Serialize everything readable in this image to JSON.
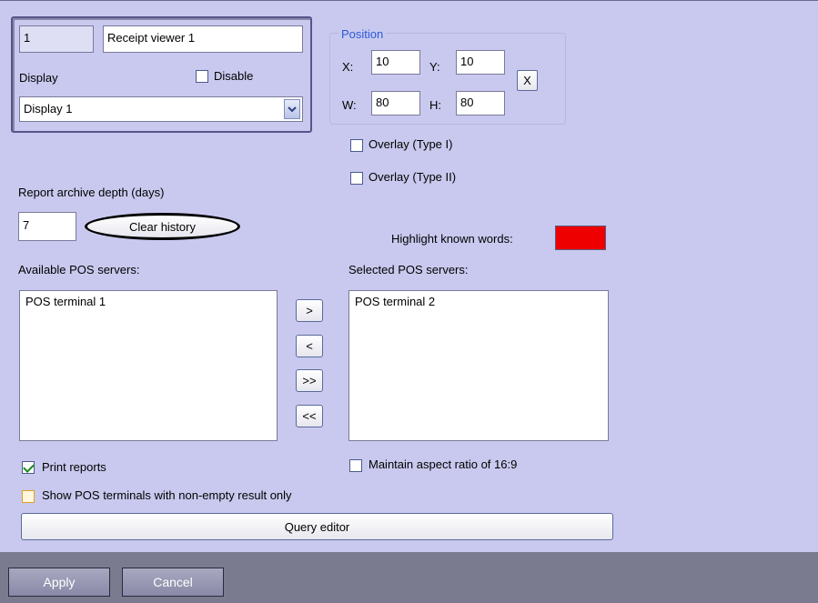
{
  "camera": {
    "id": "1",
    "name": "Receipt viewer 1"
  },
  "display": {
    "label": "Display",
    "disable_label": "Disable",
    "selected": "Display 1"
  },
  "position": {
    "title": "Position",
    "x_label": "X:",
    "x": "10",
    "y_label": "Y:",
    "y": "10",
    "w_label": "W:",
    "w": "80",
    "h_label": "H:",
    "h": "80",
    "reset_label": "X"
  },
  "overlay": {
    "type1_label": "Overlay (Type I)",
    "type2_label": "Overlay (Type II)"
  },
  "archive": {
    "label": "Report archive depth (days)",
    "days": "7",
    "clear_label": "Clear history"
  },
  "highlight": {
    "label": "Highlight known words:",
    "color": "#ee0000"
  },
  "servers": {
    "available_label": "Available POS servers:",
    "available": [
      "POS terminal 1"
    ],
    "selected_label": "Selected POS servers:",
    "selected": [
      "POS terminal 2"
    ],
    "add_label": ">",
    "remove_label": "<",
    "add_all_label": ">>",
    "remove_all_label": "<<"
  },
  "options": {
    "print_reports_label": "Print reports",
    "print_reports_checked": true,
    "nonempty_label": "Show POS terminals with non-empty result only",
    "nonempty_checked": false,
    "aspect_label": "Maintain aspect ratio of 16:9",
    "aspect_checked": false
  },
  "query_editor_label": "Query editor",
  "footer": {
    "apply_label": "Apply",
    "cancel_label": "Cancel"
  }
}
